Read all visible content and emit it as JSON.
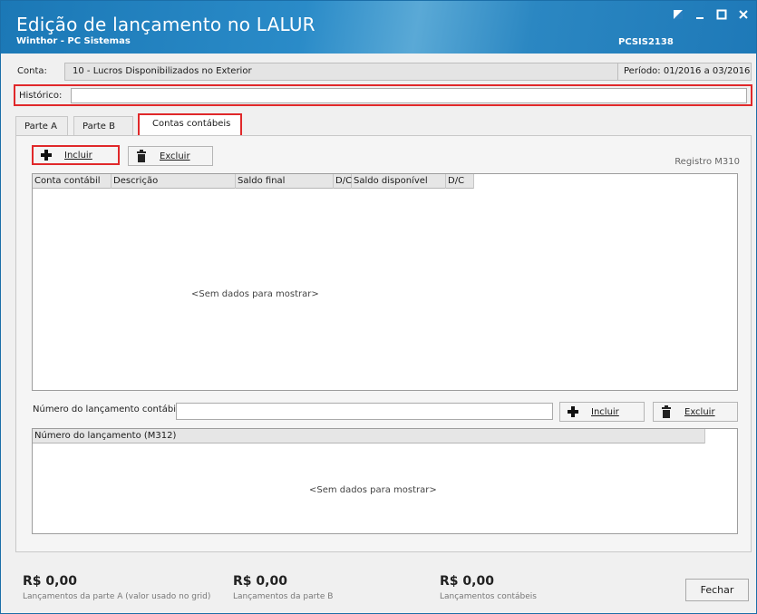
{
  "window": {
    "title": "Edição de lançamento no LALUR",
    "subtitle": "Winthor - PC Sistemas",
    "code": "PCSIS2138"
  },
  "header": {
    "conta_label": "Conta:",
    "conta_value": "10 - Lucros Disponibilizados no Exterior",
    "periodo": "Período: 01/2016 a 03/2016",
    "historico_label": "Histórico:",
    "historico_value": ""
  },
  "tabs": [
    {
      "label": "Parte A",
      "active": false
    },
    {
      "label": "Parte B",
      "active": false
    },
    {
      "label": "Contas contábeis",
      "active": true
    }
  ],
  "toolbar": {
    "incluir_label": "Incluir",
    "excluir_label": "Excluir",
    "registro": "Registro M310"
  },
  "grid_main": {
    "columns": [
      "Conta contábil",
      "Descrição",
      "Saldo final",
      "D/C",
      "Saldo disponível",
      "D/C"
    ],
    "empty_text": "<Sem dados para mostrar>"
  },
  "numero": {
    "label": "Número do lançamento contábil:",
    "value": "",
    "incluir_label": "Incluir",
    "excluir_label": "Excluir"
  },
  "grid_numero": {
    "columns": [
      "Número do lançamento (M312)"
    ],
    "empty_text": "<Sem dados para mostrar>"
  },
  "footer": {
    "totals": [
      {
        "value": "R$ 0,00",
        "desc": "Lançamentos da parte A (valor usado no grid)"
      },
      {
        "value": "R$ 0,00",
        "desc": "Lançamentos da parte B"
      },
      {
        "value": "R$ 0,00",
        "desc": "Lançamentos contábeis"
      }
    ],
    "fechar_label": "Fechar"
  },
  "colors": {
    "title_bar": "#1b78b6",
    "highlight": "#e0282a"
  },
  "icons": {
    "incluir": "plus-icon",
    "excluir": "trash-icon",
    "window": [
      "restore-icon",
      "minimize-icon",
      "maximize-icon",
      "close-icon"
    ]
  }
}
